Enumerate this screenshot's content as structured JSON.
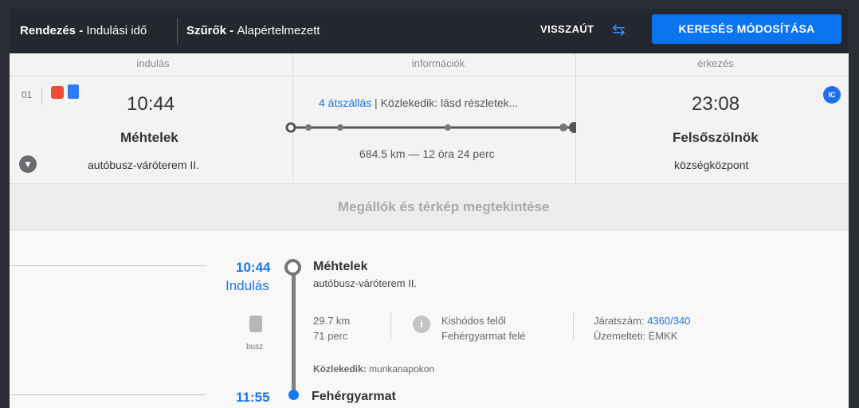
{
  "header": {
    "sort_label": "Rendezés - ",
    "sort_value": "Indulási idő",
    "filter_label": "Szűrők - ",
    "filter_value": "Alapértelmezett",
    "return_label": "VISSZAÚT",
    "modify_button": "KERESÉS MÓDOSÍTÁSA"
  },
  "columns": {
    "departure": "indulás",
    "information": "információk",
    "arrival": "érkezés"
  },
  "journey": {
    "index": "01",
    "departure_time": "10:44",
    "departure_place": "Méhtelek",
    "departure_stop": "autóbusz-váróterem II.",
    "transfers_link": "4 átszállás",
    "runs_text": " | Közlekedik: lásd részletek...",
    "distance_duration": "684.5 km — 12 óra 24 perc",
    "arrival_time": "23:08",
    "arrival_place": "Felsőszölnök",
    "arrival_stop": "községközpont",
    "badge": "IC"
  },
  "actions": {
    "stops_map": "Megállók és térkép megtekintése"
  },
  "details": {
    "start_time": "10:44",
    "start_label": "Indulás",
    "start_place": "Méhtelek",
    "start_stop": "autóbusz-váróterem II.",
    "vehicle": "busz",
    "distance": "29.7 km",
    "duration": "71 perc",
    "direction_from": "Kishódos felől",
    "direction_to": "Fehérgyarmat felé",
    "route_number_label": "Járatszám: ",
    "route_number": "4360/340",
    "operator_label": "Üzemelteti: ",
    "operator": "ÉMKK",
    "service_label": "Közlekedik: ",
    "service_days": "munkanapokon",
    "next_time": "11:55",
    "next_place": "Fehérgyarmat"
  },
  "icons": {
    "swap": "swap-arrows-icon",
    "bus": "bus-icon",
    "train": "train-icon",
    "expand": "chevron-down-icon",
    "info": "info-icon"
  }
}
